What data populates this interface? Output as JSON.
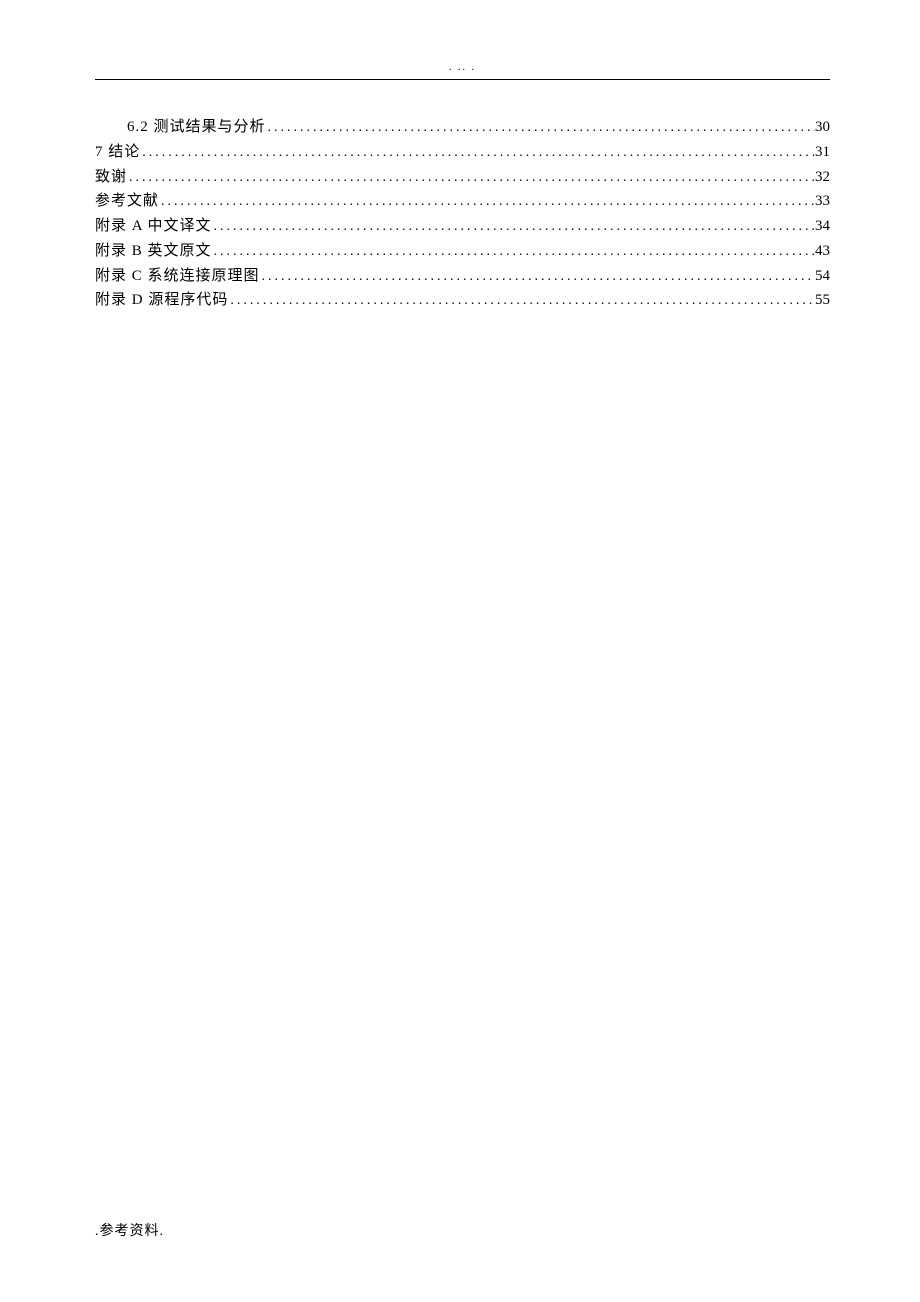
{
  "header": {
    "dots": ". .. ."
  },
  "toc": {
    "entries": [
      {
        "title": "6.2 测试结果与分析",
        "page": "30",
        "indent": true
      },
      {
        "title": "7 结论",
        "page": "31",
        "indent": false
      },
      {
        "title": "致谢",
        "page": "32",
        "indent": false
      },
      {
        "title": "参考文献",
        "page": "33",
        "indent": false
      },
      {
        "title": "附录 A 中文译文",
        "page": "34",
        "indent": false
      },
      {
        "title": "附录 B 英文原文",
        "page": "43",
        "indent": false
      },
      {
        "title": "附录 C 系统连接原理图",
        "page": "54",
        "indent": false
      },
      {
        "title": "附录 D 源程序代码",
        "page": "55",
        "indent": false
      }
    ]
  },
  "footer": {
    "text": ".参考资料."
  }
}
